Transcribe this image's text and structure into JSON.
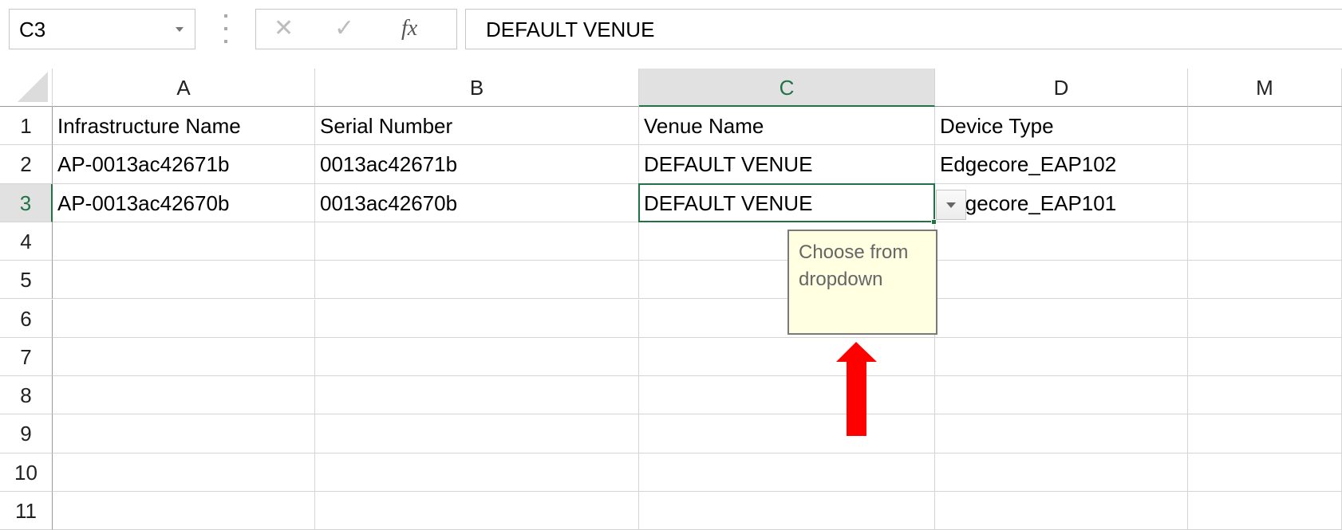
{
  "formula_bar": {
    "name_box": "C3",
    "cancel_icon": "x-icon",
    "enter_icon": "check-icon",
    "fx_label": "fx",
    "formula": "DEFAULT VENUE"
  },
  "columns": [
    "A",
    "B",
    "C",
    "D",
    "M"
  ],
  "rows": [
    "1",
    "2",
    "3",
    "4",
    "5",
    "6",
    "7",
    "8",
    "9",
    "10",
    "11"
  ],
  "cells": [
    [
      "Infrastructure Name",
      "Serial Number",
      "Venue Name",
      "Device Type",
      ""
    ],
    [
      "AP-0013ac42671b",
      "0013ac42671b",
      "DEFAULT VENUE",
      "Edgecore_EAP102",
      ""
    ],
    [
      "AP-0013ac42670b",
      "0013ac42670b",
      "DEFAULT VENUE",
      "Edgecore_EAP101",
      ""
    ]
  ],
  "selection": {
    "cell": "C3",
    "accent": "#217346"
  },
  "tooltip": {
    "text": "Choose from dropdown"
  },
  "annotation": {
    "arrow_color": "#ff0000"
  }
}
